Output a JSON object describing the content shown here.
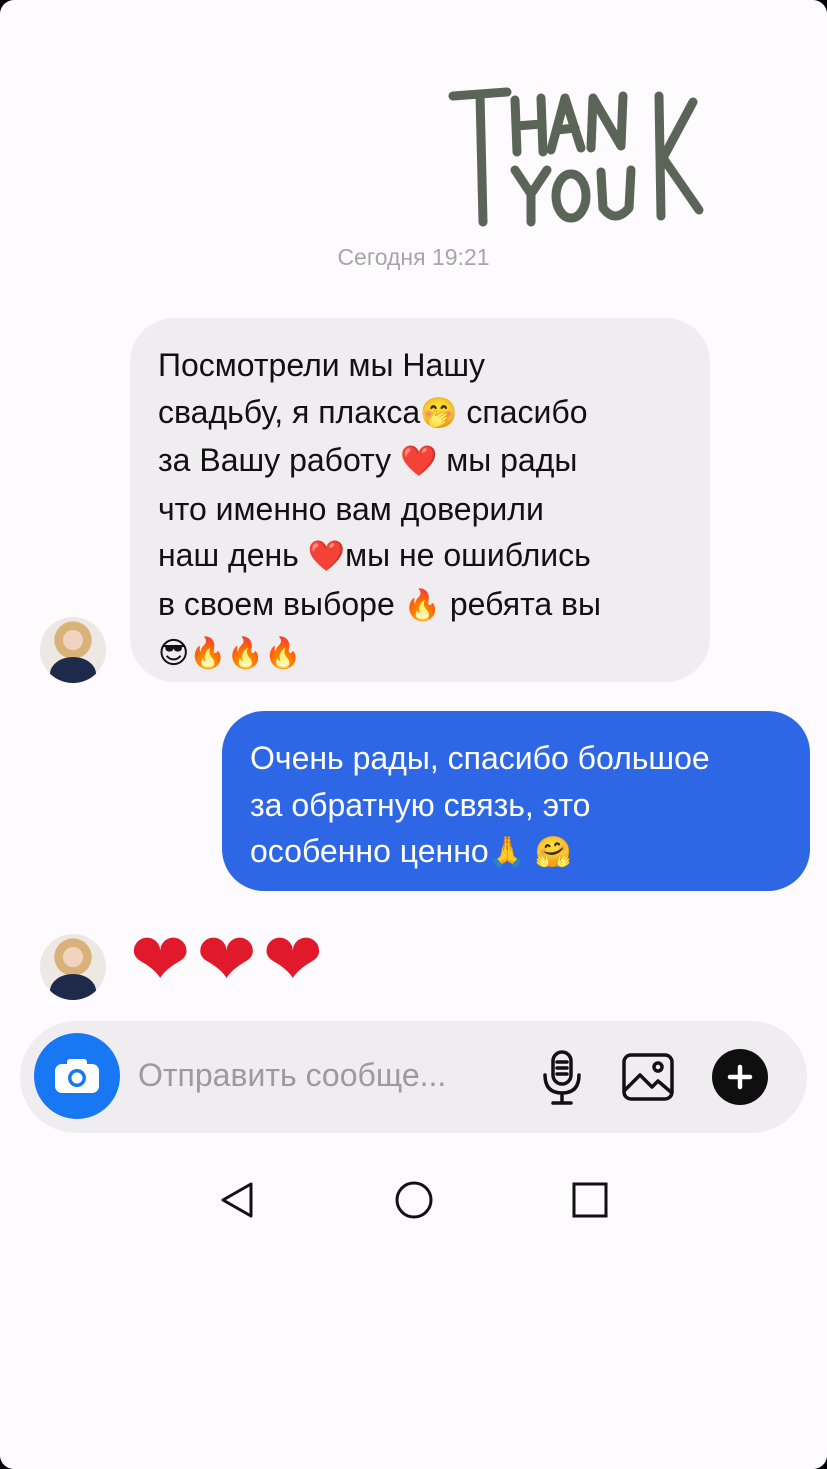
{
  "sticker": {
    "text": "THANK YOU",
    "color": "#5a6457"
  },
  "chat": {
    "timestamp": "Сегодня 19:21",
    "incoming": {
      "lines": [
        "Посмотрели мы Нашу",
        "свадьбу, я плакса",
        "спасибо",
        "за Вашу работу",
        "мы рады",
        "что именно вам доверили",
        "наш день",
        "мы не ошиблись",
        "в своем выборе",
        "ребята вы"
      ],
      "emoji": {
        "blush": "🤭",
        "heart": "❤️",
        "fire": "🔥",
        "cool": "😎"
      }
    },
    "outgoing": {
      "lines": [
        "Очень рады, спасибо большое",
        "за обратную связь, это",
        "особенно ценно"
      ],
      "emoji": {
        "pray": "🙏",
        "hug": "🤗"
      },
      "color": "#2e67e6"
    },
    "reaction_hearts": "❤❤❤"
  },
  "composer": {
    "placeholder": "Отправить сообще...",
    "camera_icon": "camera-icon",
    "mic_icon": "microphone-icon",
    "gallery_icon": "image-icon",
    "plus_icon": "plus-icon",
    "accent": "#1877f2"
  },
  "navbar": {
    "icons": [
      "back-triangle-icon",
      "home-circle-icon",
      "recents-square-icon"
    ]
  }
}
